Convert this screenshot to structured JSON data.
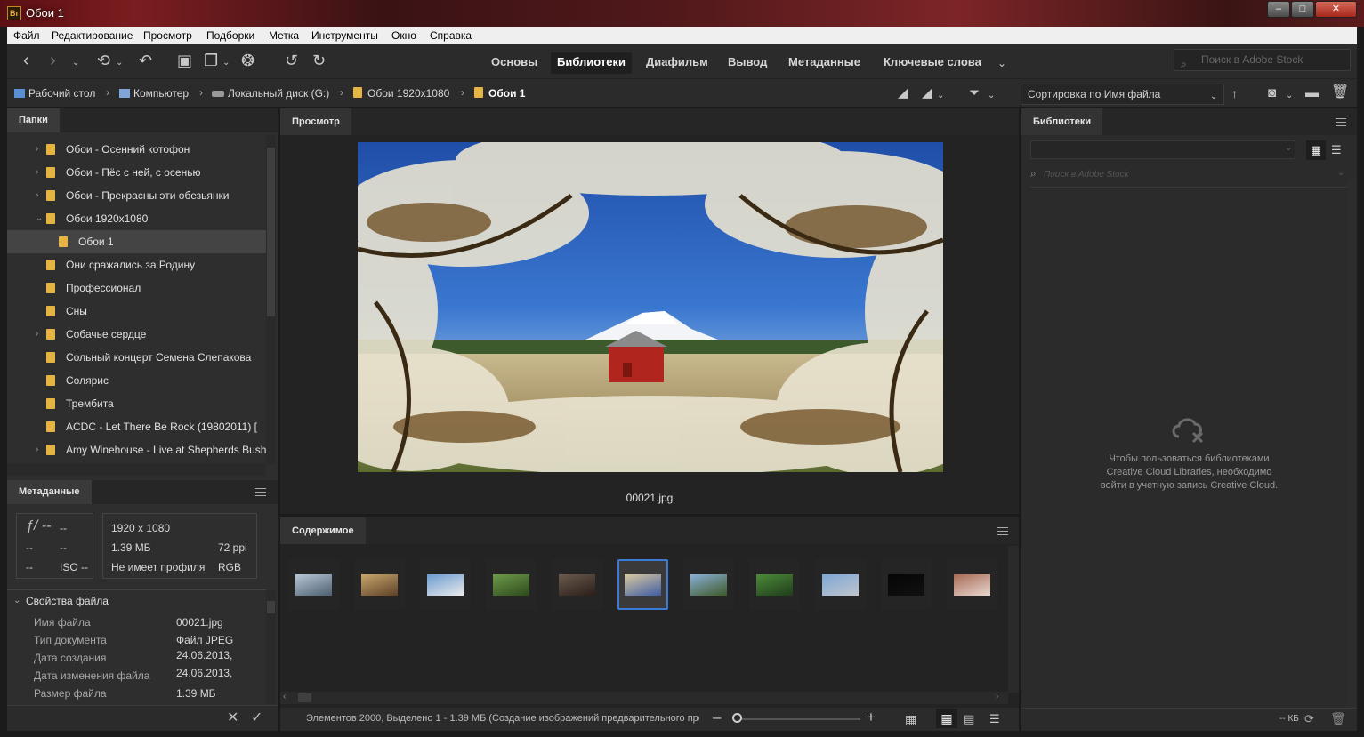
{
  "window": {
    "title": "Обои 1",
    "app_icon": "Br",
    "btn_min": "–",
    "btn_max": "□",
    "btn_close": "✕"
  },
  "menu": [
    "Файл",
    "Редактирование",
    "Просмотр",
    "Подборки",
    "Метка",
    "Инструменты",
    "Окно",
    "Справка"
  ],
  "workspaces": [
    {
      "label": "Основы",
      "active": false
    },
    {
      "label": "Библиотеки",
      "active": true
    },
    {
      "label": "Диафильм",
      "active": false
    },
    {
      "label": "Вывод",
      "active": false
    },
    {
      "label": "Метаданные",
      "active": false
    },
    {
      "label": "Ключевые слова",
      "active": false
    }
  ],
  "stock_search": {
    "placeholder": "Поиск в Adobe Stock"
  },
  "breadcrumb": [
    "Рабочий стол",
    "Компьютер",
    "Локальный диск (G:)",
    "Обои 1920x1080",
    "Обои 1"
  ],
  "sort": {
    "label": "Сортировка по Имя файла"
  },
  "folders_panel": {
    "tab": "Папки",
    "items": [
      {
        "label": "Обои - Осенний котофон",
        "chevron": "›",
        "indent": 1
      },
      {
        "label": "Обои - Пёс с ней, с осенью",
        "chevron": "›",
        "indent": 1
      },
      {
        "label": "Обои - Прекрасны эти обезьянки",
        "chevron": "›",
        "indent": 1
      },
      {
        "label": "Обои 1920x1080",
        "chevron": "⌄",
        "indent": 1
      },
      {
        "label": "Обои 1",
        "chevron": "",
        "indent": 2,
        "selected": true
      },
      {
        "label": "Они сражались за Родину",
        "chevron": "",
        "indent": 1
      },
      {
        "label": "Профессионал",
        "chevron": "",
        "indent": 1
      },
      {
        "label": "Сны",
        "chevron": "",
        "indent": 1
      },
      {
        "label": "Собачье сердце",
        "chevron": "›",
        "indent": 1
      },
      {
        "label": "Сольный концерт Семена Слепакова",
        "chevron": "",
        "indent": 1
      },
      {
        "label": "Солярис",
        "chevron": "",
        "indent": 1
      },
      {
        "label": "Трембита",
        "chevron": "",
        "indent": 1
      },
      {
        "label": "ACDC - Let There Be Rock (19802011) [",
        "chevron": "",
        "indent": 1
      },
      {
        "label": "Amy Winehouse - Live at Shepherds Bush",
        "chevron": "›",
        "indent": 1
      }
    ]
  },
  "metadata_panel": {
    "tab": "Метаданные",
    "camera": {
      "fstop": "ƒ/ --",
      "f2": "--",
      "row2a": "--",
      "row2b": "--",
      "row3a": "--",
      "iso": "ISO --"
    },
    "file": {
      "dimensions": "1920 x 1080",
      "size": "1.39 МБ",
      "ppi": "72 ppi",
      "profile": "Не имеет профиля",
      "mode": "RGB"
    },
    "section_title": "Свойства файла",
    "properties": [
      {
        "label": "Имя файла",
        "value": "00021.jpg"
      },
      {
        "label": "Тип документа",
        "value": "Файл JPEG"
      },
      {
        "label": "Дата создания",
        "value": "24.06.2013,"
      },
      {
        "label": "Дата изменения файла",
        "value": "24.06.2013,"
      },
      {
        "label": "Размер файла",
        "value": "1.39 МБ"
      }
    ],
    "cancel_icon": "✕",
    "apply_icon": "✓"
  },
  "preview_panel": {
    "tab": "Просмотр",
    "filename": "00021.jpg"
  },
  "content_panel": {
    "tab": "Содержимое",
    "thumbnails": [
      {
        "colors": [
          "#b8c7d6",
          "#4d5f70"
        ],
        "selected": false
      },
      {
        "colors": [
          "#c9a56c",
          "#5e4228"
        ],
        "selected": false
      },
      {
        "colors": [
          "#6b9bd1",
          "#eaeaea"
        ],
        "selected": false
      },
      {
        "colors": [
          "#6d9a4a",
          "#2e4a1c"
        ],
        "selected": false
      },
      {
        "colors": [
          "#6b5a4d",
          "#2a1e1a"
        ],
        "selected": false
      },
      {
        "colors": [
          "#d9c9a0",
          "#3f5da3"
        ],
        "selected": true
      },
      {
        "colors": [
          "#89b0d6",
          "#3f5a2a"
        ],
        "selected": false
      },
      {
        "colors": [
          "#4d8a3a",
          "#1f3d1a"
        ],
        "selected": false
      },
      {
        "colors": [
          "#7ea6d6",
          "#c0c6cc"
        ],
        "selected": false
      },
      {
        "colors": [
          "#050505",
          "#111111"
        ],
        "selected": false
      },
      {
        "colors": [
          "#a86a55",
          "#e8d8d0"
        ],
        "selected": false
      }
    ]
  },
  "status": {
    "text": "Элементов 2000, Выделено 1 - 1.39 МБ (Создание изображений предварительного про"
  },
  "libraries_panel": {
    "tab": "Библиотеки",
    "search_placeholder": "Поиск в Adobe Stock",
    "message_lines": [
      "Чтобы пользоваться библиотеками",
      "Creative Cloud Libraries, необходимо",
      "войти в учетную запись Creative Cloud."
    ],
    "footer_size": "-- КБ"
  },
  "colors": {
    "accent": "#3b7ad6",
    "folder": "#e4b543",
    "panel": "#2e2e2e",
    "title_bar": "#6b1a1d"
  }
}
